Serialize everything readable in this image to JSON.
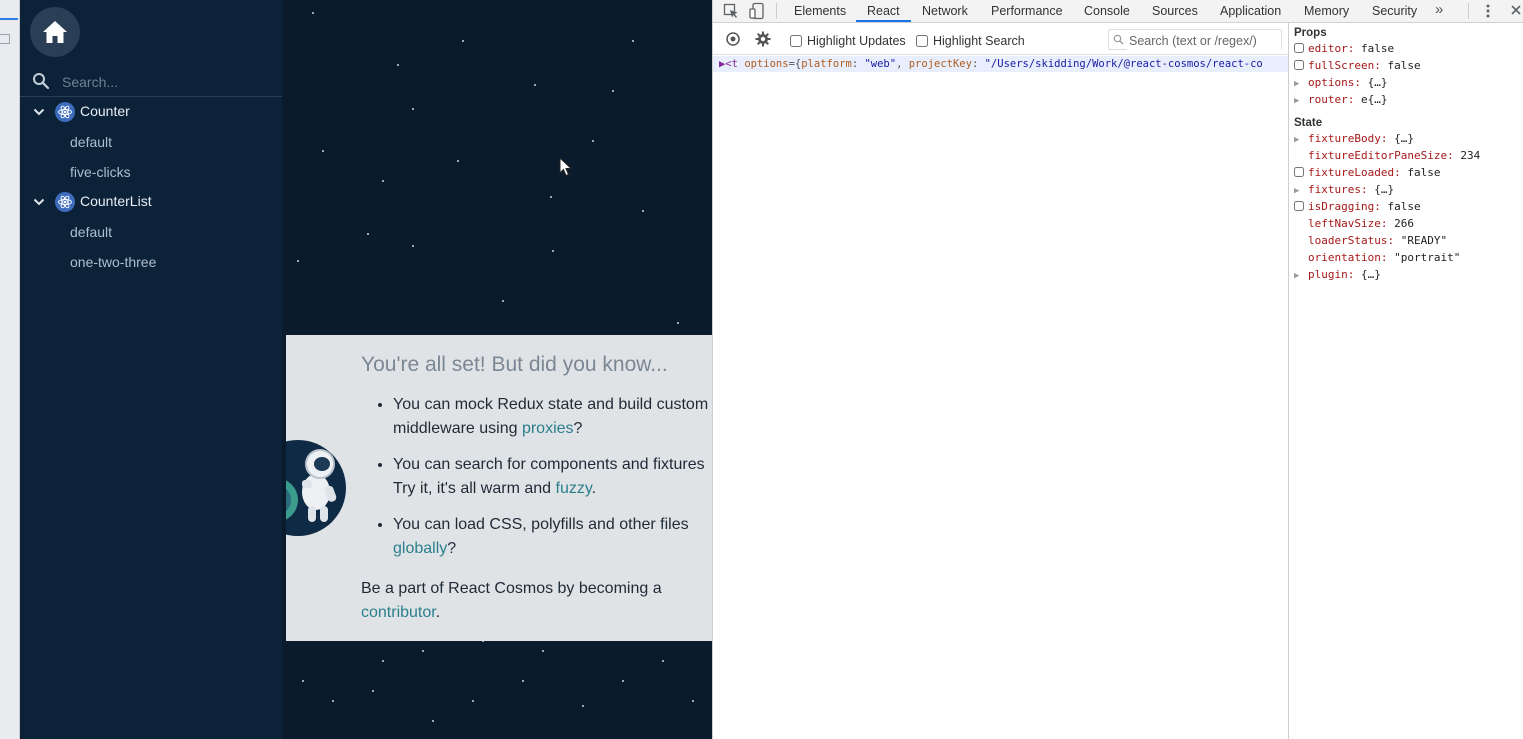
{
  "sidebar": {
    "search_placeholder": "Search...",
    "groups": [
      {
        "label": "Counter",
        "items": [
          "default",
          "five-clicks"
        ]
      },
      {
        "label": "CounterList",
        "items": [
          "default",
          "one-two-three"
        ]
      }
    ]
  },
  "preview": {
    "title": "You're all set! But did you know...",
    "tips": [
      {
        "pre": "You can mock Redux state and build custom",
        "line2_pre": "middleware using ",
        "link": "proxies",
        "post": "?"
      },
      {
        "pre": "You can search for components and fixtures",
        "line2_pre": "Try it, it's all warm and ",
        "link": "fuzzy",
        "post": "."
      },
      {
        "pre": "You can load CSS, polyfills and other files",
        "line2_pre": "",
        "link": "globally",
        "post": "?"
      }
    ],
    "footer_pre": "Be a part of React Cosmos by becoming a",
    "footer_link": "contributor",
    "footer_post": "."
  },
  "devtools": {
    "tabs": [
      "Elements",
      "React",
      "Network",
      "Performance",
      "Console",
      "Sources",
      "Application",
      "Memory",
      "Security"
    ],
    "active_tab": "React",
    "more": "»",
    "toolbar": {
      "highlight_updates": "Highlight Updates",
      "highlight_search": "Highlight Search",
      "search_placeholder": "Search (text or /regex/)"
    },
    "tree": {
      "tag_open": "<t",
      "attr": "options",
      "eq_open": "={",
      "k1": "platform",
      "v1": "\"web\"",
      "k2": "projectKey",
      "v2": "\"/Users/skidding/Work/@react-cosmos/react-co"
    },
    "props_title": "Props",
    "props": [
      {
        "key": "editor",
        "val": "false",
        "kind": "check"
      },
      {
        "key": "fullScreen",
        "val": "false",
        "kind": "check"
      },
      {
        "key": "options",
        "val": "{…}",
        "kind": "expand"
      },
      {
        "key": "router",
        "val": "e{…}",
        "kind": "expand"
      }
    ],
    "state_title": "State",
    "state": [
      {
        "key": "fixtureBody",
        "val": "{…}",
        "kind": "expand"
      },
      {
        "key": "fixtureEditorPaneSize",
        "val": "234",
        "kind": "none"
      },
      {
        "key": "fixtureLoaded",
        "val": "false",
        "kind": "check"
      },
      {
        "key": "fixtures",
        "val": "{…}",
        "kind": "expand"
      },
      {
        "key": "isDragging",
        "val": "false",
        "kind": "check"
      },
      {
        "key": "leftNavSize",
        "val": "266",
        "kind": "none"
      },
      {
        "key": "loaderStatus",
        "val": "\"READY\"",
        "kind": "none"
      },
      {
        "key": "orientation",
        "val": "\"portrait\"",
        "kind": "none"
      },
      {
        "key": "plugin",
        "val": "{…}",
        "kind": "expand"
      }
    ]
  }
}
